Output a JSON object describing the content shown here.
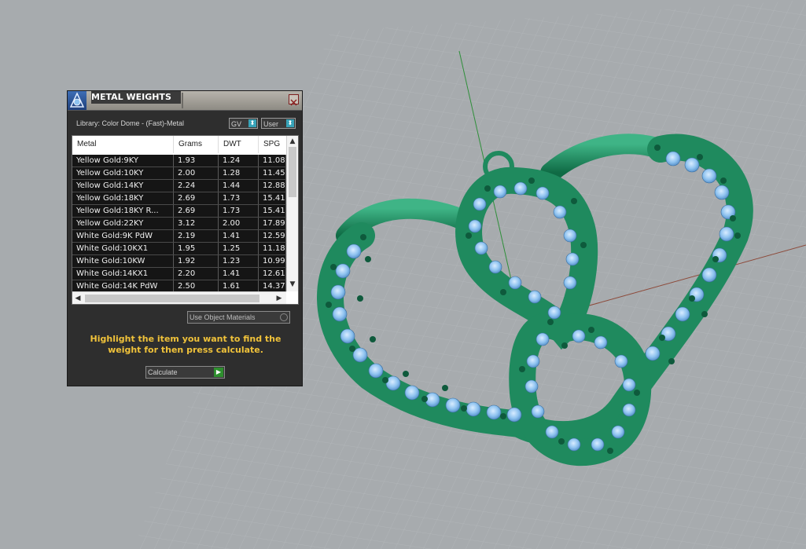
{
  "panel": {
    "title": "METAL WEIGHTS",
    "library_label": "Library: Color Dome - (Fast)-Metal",
    "spin_gv": "GV",
    "spin_user": "User",
    "columns": [
      "Metal",
      "Grams",
      "DWT",
      "SPG"
    ],
    "rows": [
      {
        "metal": "Yellow Gold:9KY",
        "grams": "1.93",
        "dwt": "1.24",
        "spg": "11.08"
      },
      {
        "metal": "Yellow Gold:10KY",
        "grams": "2.00",
        "dwt": "1.28",
        "spg": "11.45"
      },
      {
        "metal": "Yellow Gold:14KY",
        "grams": "2.24",
        "dwt": "1.44",
        "spg": "12.88"
      },
      {
        "metal": "Yellow Gold:18KY",
        "grams": "2.69",
        "dwt": "1.73",
        "spg": "15.41"
      },
      {
        "metal": "Yellow Gold:18KY R...",
        "grams": "2.69",
        "dwt": "1.73",
        "spg": "15.41"
      },
      {
        "metal": "Yellow Gold:22KY",
        "grams": "3.12",
        "dwt": "2.00",
        "spg": "17.89"
      },
      {
        "metal": "White Gold:9K PdW",
        "grams": "2.19",
        "dwt": "1.41",
        "spg": "12.59"
      },
      {
        "metal": "White Gold:10KX1",
        "grams": "1.95",
        "dwt": "1.25",
        "spg": "11.18"
      },
      {
        "metal": "White Gold:10KW",
        "grams": "1.92",
        "dwt": "1.23",
        "spg": "10.99"
      },
      {
        "metal": "White Gold:14KX1",
        "grams": "2.20",
        "dwt": "1.41",
        "spg": "12.61"
      },
      {
        "metal": "White Gold:14K PdW",
        "grams": "2.50",
        "dwt": "1.61",
        "spg": "14.37"
      }
    ],
    "use_object_materials": "Use Object Materials",
    "hint": "Highlight the item you want to find the weight for then press calculate.",
    "calculate": "Calculate"
  },
  "colors": {
    "viewport_bg": "#a7abae",
    "grid_minor": "#b2b6b9",
    "grid_major": "#9da1a4",
    "metal_green": "#1f8a5e",
    "gem_blue": "#8fc3f0",
    "bead_green": "#0e5a3c",
    "hint_yellow": "#f0c23a"
  }
}
